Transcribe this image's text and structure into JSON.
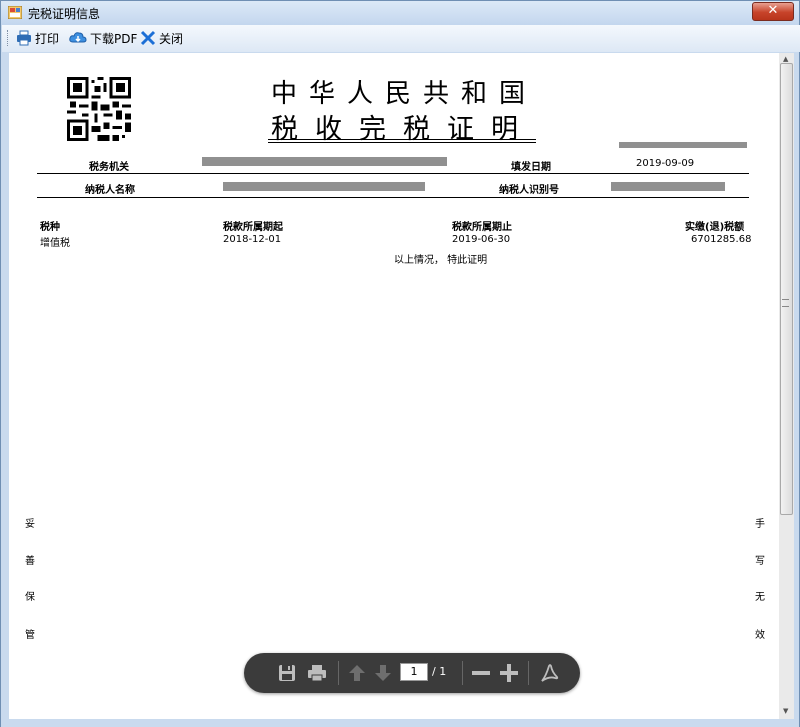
{
  "window": {
    "title": "完税证明信息",
    "close_glyph": "✕"
  },
  "toolbar": {
    "print_label": "打印",
    "download_label": "下载PDF",
    "close_label": "关闭"
  },
  "certificate": {
    "title_line1": "中华人民共和国",
    "title_line2": "税收完税证明",
    "header": {
      "tax_authority_label": "税务机关",
      "fill_date_label": "填发日期",
      "fill_date_value": "2019-09-09",
      "taxpayer_name_label": "纳税人名称",
      "taxpayer_id_label": "纳税人识别号"
    },
    "table": {
      "columns": [
        "税种",
        "税款所属期起",
        "税款所属期止",
        "实缴(退)税额"
      ],
      "rows": [
        [
          "增值税",
          "2018-12-01",
          "2019-06-30",
          "6701285.68"
        ]
      ]
    },
    "footer_note": "以上情况， 特此证明",
    "left_vertical": [
      "妥",
      "善",
      "保",
      "管"
    ],
    "right_vertical": [
      "手",
      "写",
      "无",
      "效"
    ]
  },
  "pdf_controls": {
    "page_current": "1",
    "page_total": "/ 1"
  }
}
